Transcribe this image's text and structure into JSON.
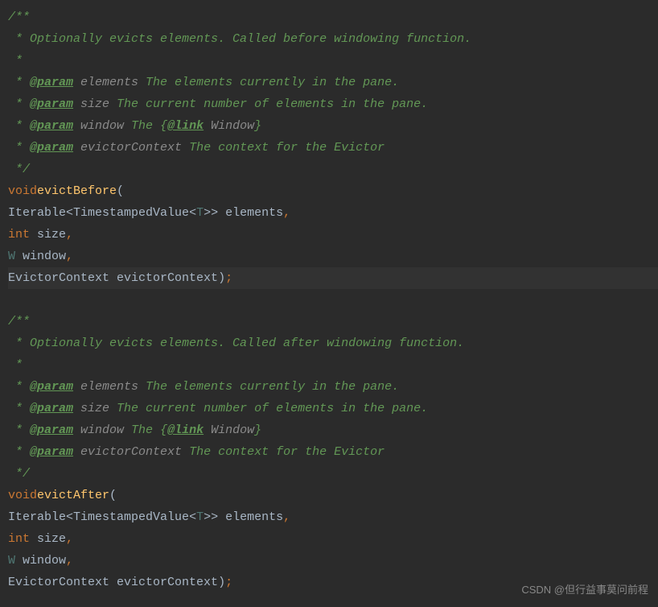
{
  "doc1": {
    "open": "/**",
    "line1": " * Optionally evicts elements. Called before windowing function.",
    "empty": " *",
    "param_tag": "@param",
    "param_elements": " elements",
    "param_elements_desc": " The elements currently in the pane.",
    "param_size": " size",
    "param_size_desc": " The current number of elements in the pane.",
    "param_window": " window",
    "param_window_desc1": " The {",
    "link_tag": "@link",
    "link_target": " Window",
    "param_window_desc2": "}",
    "param_evictor": " evictorContext",
    "param_evictor_desc": " The context for the Evictor",
    "close": " */",
    "star_prefix": " * "
  },
  "method1": {
    "keyword_void": "void",
    "name": "evictBefore",
    "open_paren": "(",
    "type_iterable": "Iterable",
    "lt": "<",
    "type_timestamped": "TimestampedValue",
    "generic_t": "T",
    "gt": ">",
    "gt2": ">>",
    "param_elements": " elements",
    "keyword_int": "int",
    "param_size": " size",
    "type_w": "W",
    "param_window": " window",
    "type_evictor_ctx": "EvictorContext",
    "param_evictor_ctx": " evictorContext",
    "close_paren": ")",
    "comma": ",",
    "semicolon": ";"
  },
  "doc2": {
    "open": "/**",
    "line1": " * Optionally evicts elements. Called after windowing function.",
    "empty": " *",
    "param_tag": "@param",
    "param_elements": " elements",
    "param_elements_desc": " The elements currently in the pane.",
    "param_size": " size",
    "param_size_desc": " The current number of elements in the pane.",
    "param_window": " window",
    "param_window_desc1": " The {",
    "link_tag": "@link",
    "link_target": " Window",
    "param_window_desc2": "}",
    "param_evictor": " evictorContext",
    "param_evictor_desc": " The context for the Evictor",
    "close": " */",
    "star_prefix": " * "
  },
  "method2": {
    "keyword_void": "void",
    "name": "evictAfter",
    "open_paren": "(",
    "type_iterable": "Iterable",
    "lt": "<",
    "type_timestamped": "TimestampedValue",
    "generic_t": "T",
    "gt2": ">>",
    "param_elements": " elements",
    "keyword_int": "int",
    "param_size": " size",
    "type_w": "W",
    "param_window": " window",
    "type_evictor_ctx": "EvictorContext",
    "param_evictor_ctx": " evictorContext",
    "close_paren": ")",
    "comma": ",",
    "semicolon": ";"
  },
  "watermark": "CSDN @但行益事莫问前程"
}
